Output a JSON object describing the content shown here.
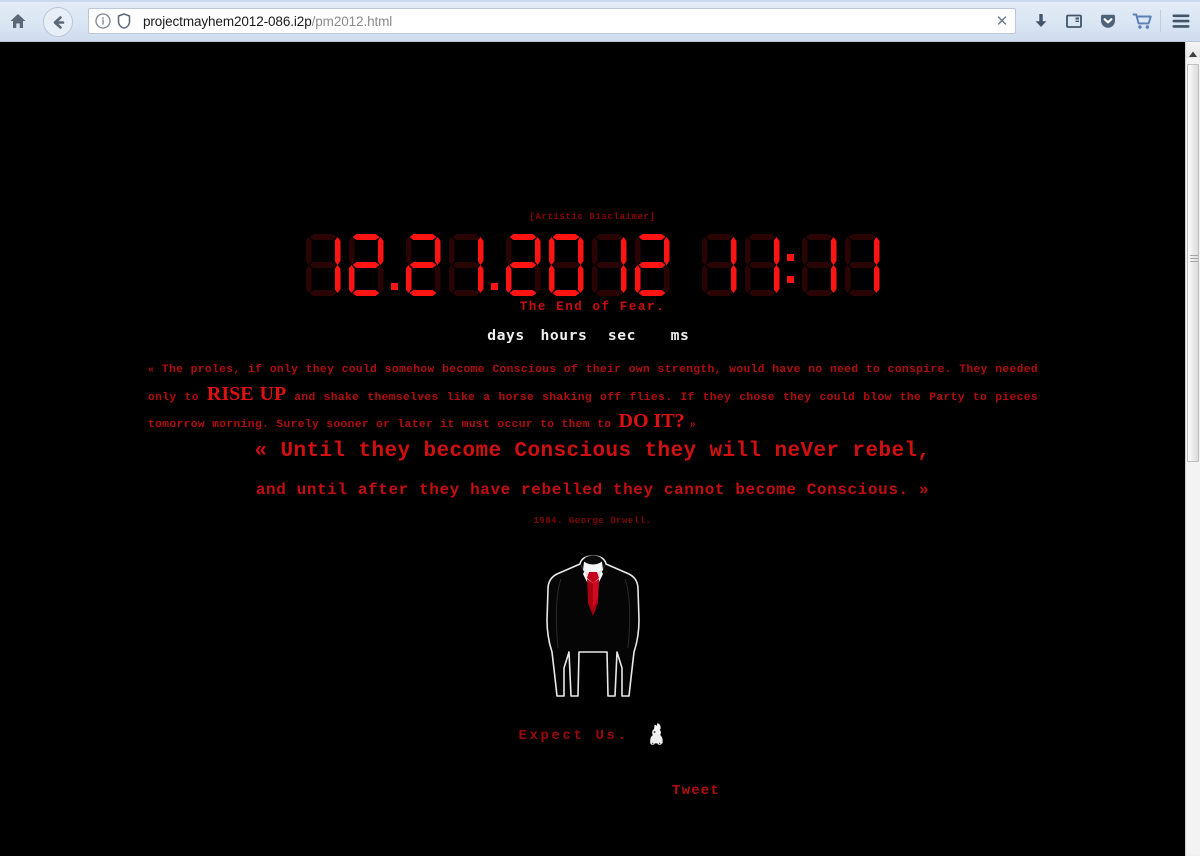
{
  "browser": {
    "url_host": "projectmayhem2012-086.i2p",
    "url_path": "/pm2012.html",
    "clear_label": "✕",
    "icons": {
      "home": "home-icon",
      "back": "back-arrow-icon",
      "info": "info-icon",
      "shield": "shield-icon",
      "download": "download-icon",
      "reader": "reader-view-icon",
      "pocket": "pocket-icon",
      "cart": "cart-icon",
      "menu": "hamburger-menu-icon"
    }
  },
  "page": {
    "disclaimer": "[Artistic Disclaimer]",
    "clock": {
      "date_digits": [
        "1",
        "2",
        ".",
        "2",
        "1",
        ".",
        "2",
        "0",
        "1",
        "2"
      ],
      "time_digits": [
        "1",
        "1",
        ":",
        "1",
        "1"
      ],
      "date_text": "12.21.2012",
      "time_text": "11:11",
      "color_on": "#ff1414",
      "color_off": "#2a0404"
    },
    "tagline": "The End of Fear.",
    "units": [
      "days",
      "hours",
      "sec",
      "ms"
    ],
    "proles_paragraph": {
      "open_guillemet": "«",
      "part1": " The proles, if only they could somehow become Conscious of their own strength, would have no need to conspire. They needed only to ",
      "emphasis1": "RISE UP",
      "part2": " and shake themselves like a horse shaking off flies. If they chose they could blow the Party to pieces tomorrow morning. Surely sooner or later it must occur to them to ",
      "emphasis2": "DO IT",
      "part3": "? ",
      "close_guillemet": "»"
    },
    "quote_line1": "« Until they become Conscious they will neVer rebel,",
    "quote_line2": "and until after they have rebelled they cannot become Conscious. »",
    "attribution": "1984. George Orwell.",
    "figure_alt": "anonymous-headless-suit",
    "expect_us": "Expect  Us.",
    "rabbit_alt": "white-rabbit-icon",
    "tweet_label": "Tweet",
    "colors": {
      "background": "#000000",
      "text_red": "#b30c0c",
      "bright_red": "#e01010",
      "tie_red": "#b40012"
    }
  },
  "scrollbar": {
    "position": "right",
    "thumb_top_pct": 1,
    "thumb_height_pct": 50
  }
}
